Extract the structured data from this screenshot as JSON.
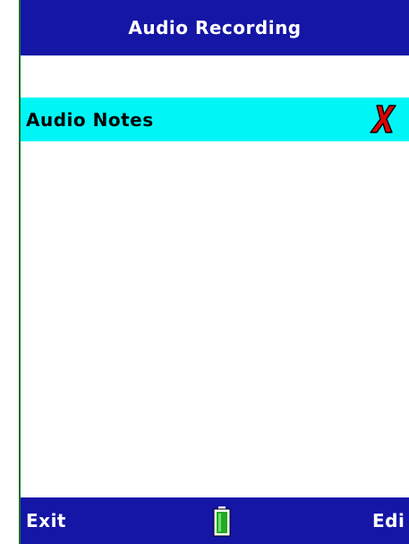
{
  "header": {
    "title": "Audio Recording"
  },
  "list": {
    "items": [
      {
        "label": "Audio Notes",
        "status_icon": "red-x-icon",
        "selected": true
      }
    ]
  },
  "softkeys": {
    "left_label": "Exit",
    "right_label": "Edi",
    "center_icon": "battery-icon"
  },
  "colors": {
    "bar_background": "#1515a6",
    "selection_background": "#00f6f6",
    "border": "#1f6f2c",
    "x_icon": "#e00000",
    "battery_fill": "#22aa22"
  }
}
